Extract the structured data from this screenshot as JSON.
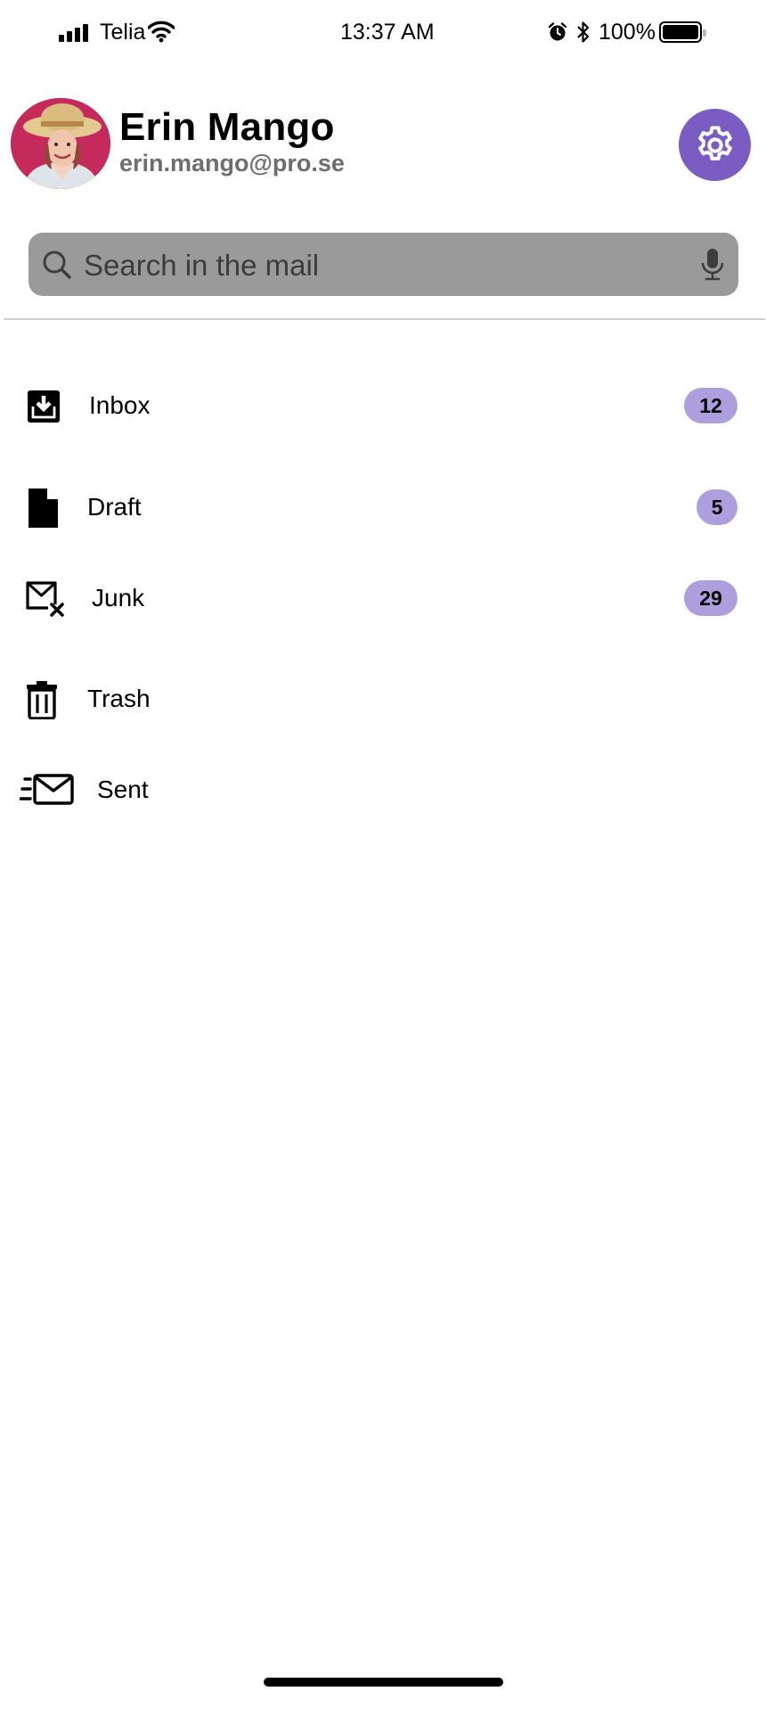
{
  "status_bar": {
    "carrier": "Telia",
    "time": "13:37 AM",
    "battery": "100%",
    "icons": [
      "signal-icon",
      "wifi-icon",
      "alarm-icon",
      "bluetooth-icon",
      "battery-icon"
    ]
  },
  "profile": {
    "name": "Erin Mango",
    "email": "erin.mango@pro.se",
    "avatar": "avatar-photo"
  },
  "search": {
    "placeholder": "Search in the mail"
  },
  "folders": [
    {
      "label": "Inbox",
      "badge": "12",
      "icon": "inbox-icon"
    },
    {
      "label": "Draft",
      "badge": "5",
      "icon": "draft-icon"
    },
    {
      "label": "Junk",
      "badge": "29",
      "icon": "junk-icon"
    },
    {
      "label": "Trash",
      "badge": "",
      "icon": "trash-icon"
    },
    {
      "label": "Sent",
      "badge": "",
      "icon": "sent-icon"
    }
  ],
  "colors": {
    "accent": "#7a5cc2",
    "badge": "#ad9fde",
    "search_bg": "#9a9a9a",
    "email_text": "#6e6e6e"
  }
}
